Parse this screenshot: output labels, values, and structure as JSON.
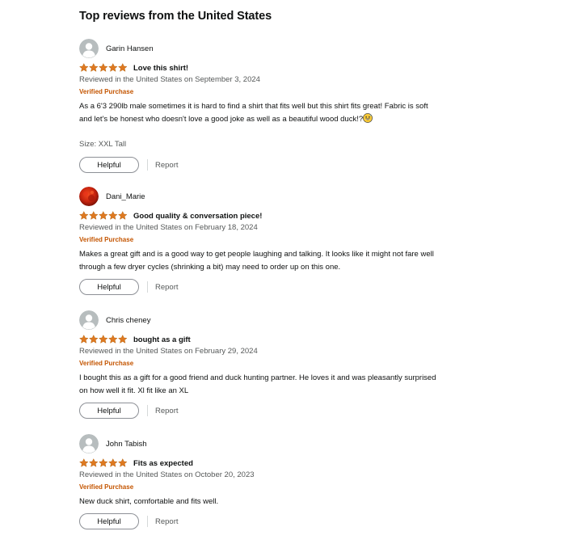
{
  "section": {
    "title": "Top reviews from the United States"
  },
  "colors": {
    "star": "#de7921",
    "verified": "#c45500",
    "secondary_text": "#565959",
    "avatar_bg": "#b7bdbe"
  },
  "reviews": [
    {
      "reviewer": "Garin Hansen",
      "avatar_icon": "default-avatar-icon",
      "rating": 5,
      "title": "Love this shirt!",
      "date": "Reviewed in the United States on September 3, 2024",
      "verified": "Verified Purchase",
      "body_line1": "As a 6'3 290lb male sometimes it is hard to find a shirt that fits well but this shirt fits great! Fabric is soft",
      "body_line2": "and let's be honest who doesn't love a good joke as well as a beautiful wood duck!?",
      "size": "Size: XXL Tall",
      "helpful_label": "Helpful",
      "report_label": "Report"
    },
    {
      "reviewer": "Dani_Marie",
      "avatar_icon": "photo-avatar-icon",
      "rating": 5,
      "title": "Good quality & conversation piece!",
      "date": "Reviewed in the United States on February 18, 2024",
      "verified": "Verified Purchase",
      "body_line1": "Makes a great gift and is a good way to get people laughing and talking. It looks like it might not fare well",
      "body_line2": "through a few dryer cycles (shrinking a bit) may need to order up on this one.",
      "helpful_label": "Helpful",
      "report_label": "Report"
    },
    {
      "reviewer": "Chris cheney",
      "avatar_icon": "default-avatar-icon",
      "rating": 5,
      "title": "bought as a gift",
      "date": "Reviewed in the United States on February 29, 2024",
      "verified": "Verified Purchase",
      "body_line1": "I bought this as a gift for a good friend and duck hunting partner. He loves it and was pleasantly surprised",
      "body_line2": "on how well it fit. Xl fit like an XL",
      "helpful_label": "Helpful",
      "report_label": "Report"
    },
    {
      "reviewer": "John Tabish",
      "avatar_icon": "default-avatar-icon",
      "rating": 5,
      "title": "Fits as expected",
      "date": "Reviewed in the United States on October 20, 2023",
      "verified": "Verified Purchase",
      "body_line1": "New duck shirt, comfortable and fits well.",
      "helpful_label": "Helpful",
      "report_label": "Report"
    }
  ]
}
